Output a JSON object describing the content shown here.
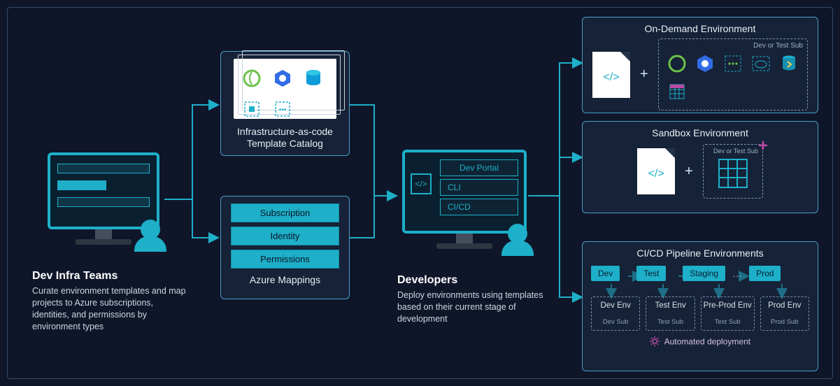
{
  "devInfra": {
    "title": "Dev Infra Teams",
    "desc": "Curate environment templates and map projects to Azure subscriptions, identities, and permissions by environment types"
  },
  "iac": {
    "label": "Infrastructure-as-code Template Catalog"
  },
  "mappings": {
    "title": "Azure Mappings",
    "items": [
      "Subscription",
      "Identity",
      "Permissions"
    ]
  },
  "developers": {
    "title": "Developers",
    "desc": "Deploy environments using templates based on their current stage of development",
    "screen": [
      "Dev Portal",
      "CLI",
      "CI/CD"
    ]
  },
  "envs": {
    "ondemand": {
      "title": "On-Demand Environment",
      "sublabel": "Dev or Test Sub"
    },
    "sandbox": {
      "title": "Sandbox Environment",
      "sublabel": "Dev or Test Sub"
    }
  },
  "pipeline": {
    "title": "CI/CD Pipeline Environments",
    "stages": [
      "Dev",
      "Test",
      "Staging",
      "Prod"
    ],
    "ellipsis": "…",
    "envs": [
      {
        "name": "Dev Env",
        "sub": "Dev Sub"
      },
      {
        "name": "Test Env",
        "sub": "Test Sub"
      },
      {
        "name": "Pre-Prod Env",
        "sub": "Test Sub"
      },
      {
        "name": "Prod Env",
        "sub": "Prod Sub"
      }
    ],
    "auto": "Automated deployment"
  },
  "codeGlyph": "</>",
  "plus": "+"
}
